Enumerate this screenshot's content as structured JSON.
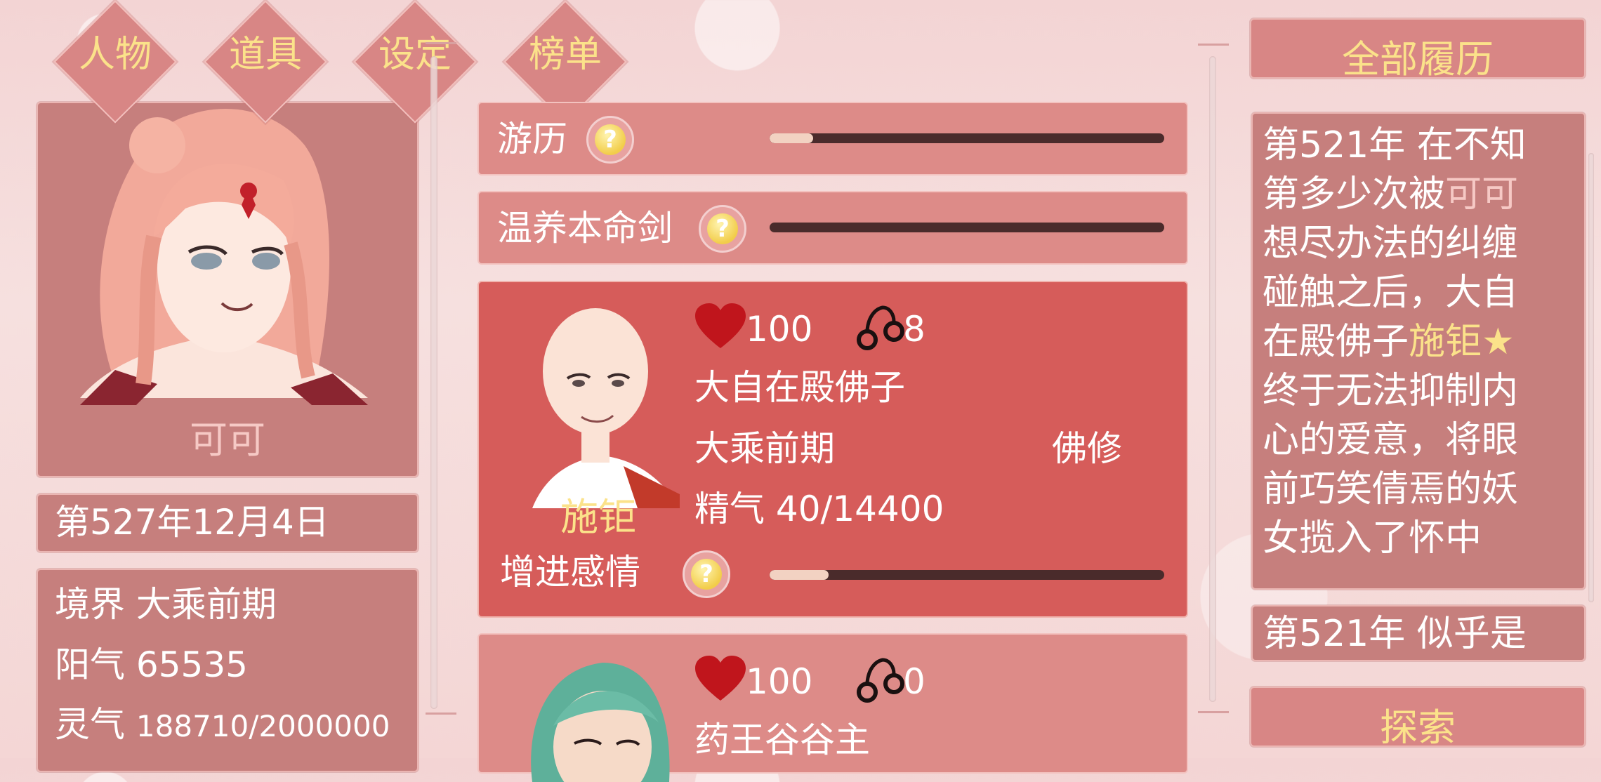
{
  "tabs": [
    {
      "label": "人物"
    },
    {
      "label": "道具"
    },
    {
      "label": "设定"
    },
    {
      "label": "榜单"
    }
  ],
  "character": {
    "name": "可可",
    "date": "第527年12月4日",
    "stats": {
      "realm_label": "境界",
      "realm_value": "大乘前期",
      "yang_label": "阳气",
      "yang_value": "65535",
      "ling_label": "灵气",
      "ling_value": "188710/2000000"
    }
  },
  "actions": [
    {
      "label": "游历",
      "progress": 0.11
    },
    {
      "label": "温养本命剑",
      "progress": 0.0
    }
  ],
  "npcs": [
    {
      "name": "施钜",
      "hearts": "100",
      "shackles": "8",
      "title": "大自在殿佛子",
      "realm": "大乘前期",
      "path": "佛修",
      "essence": "精气 40/14400",
      "action_label": "增进感情",
      "affection_progress": 0.15
    },
    {
      "hearts": "100",
      "shackles": "0",
      "title": "药王谷谷主"
    }
  ],
  "history": {
    "header": "全部履历",
    "entry1": {
      "p1": "第521年 在不知第多少次被",
      "hl1": "可可",
      "p2": "想尽办法的纠缠碰触之后，大自在殿佛子",
      "hl2": "施钜★",
      "p3": "终于无法抑制内心的爱意，将眼前巧笑倩焉的妖女揽入了怀中"
    },
    "entry2": "第521年 似乎是",
    "explore_button": "探索"
  },
  "colors": {
    "panel": "#c67f7d",
    "selected_card": "#d65c5a",
    "gold_text": "#fbe28a"
  }
}
